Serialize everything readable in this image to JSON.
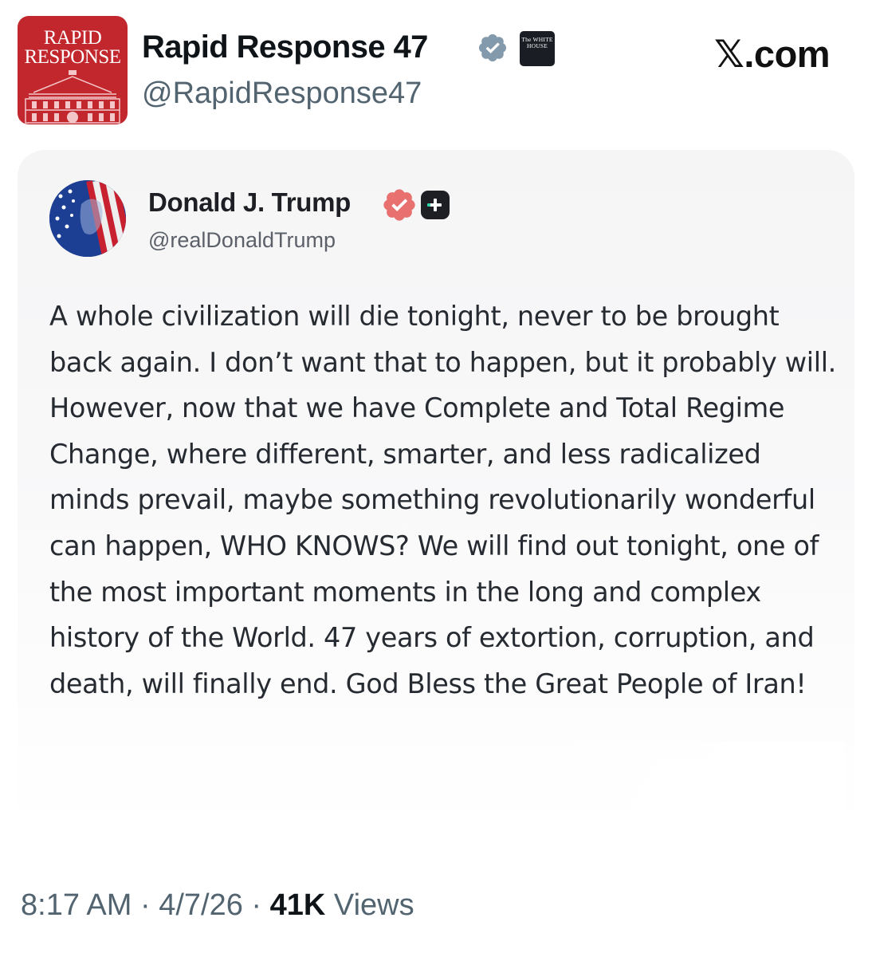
{
  "outer_tweet": {
    "avatar_text_line1": "RAPID",
    "avatar_text_line2": "RESPONSE",
    "display_name": "Rapid Response 47",
    "handle": "@RapidResponse47",
    "affiliate_badge_text": "The WHITE HOUSE",
    "brand": "𝕏.com"
  },
  "embedded_post": {
    "display_name": "Donald J. Trump",
    "handle": "@realDonaldTrump",
    "text": "A whole civilization will die tonight, never to be brought back again. I don’t want that to happen, but it probably will. However, now that we have Complete and Total Regime Change, where different, smarter, and less radicalized minds prevail, maybe something revolutionarily wonderful can happen, WHO KNOWS? We will find out tonight, one of the most important moments in the long and complex history of the World. 47 years of extortion, corruption, and death, will finally end. God Bless the Great People of Iran!"
  },
  "footer": {
    "time": "8:17 AM",
    "separator": " · ",
    "date": "4/7/26",
    "views_count": "41K",
    "views_label": " Views"
  },
  "colors": {
    "rapid_response_red": "#c1272d",
    "verified_gray": "#829aab",
    "truth_verified_pink": "#e8716f",
    "secondary_text": "#536471"
  },
  "icons": [
    "verified-badge-icon",
    "white-house-badge-icon",
    "truth-verified-icon",
    "truth-plus-icon"
  ]
}
